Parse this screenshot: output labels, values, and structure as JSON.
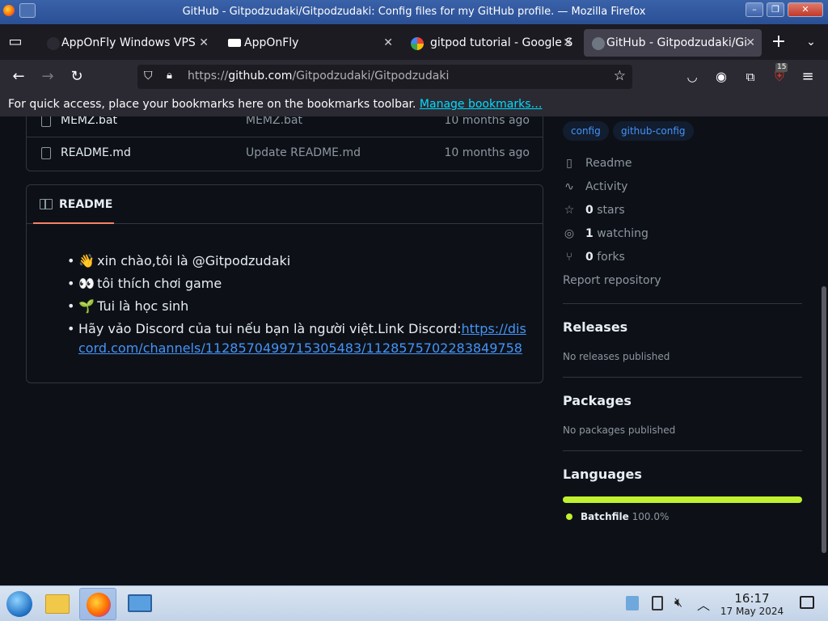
{
  "window": {
    "title": "GitHub - Gitpodzudaki/Gitpodzudaki: Config files for my GitHub profile. — Mozilla Firefox"
  },
  "tabs": [
    {
      "label": "AppOnFly Windows VPS",
      "favicon_color": "#2b2a33",
      "active": false
    },
    {
      "label": "AppOnFly",
      "favicon_color": "#ffffff",
      "active": false
    },
    {
      "label": "gitpod tutorial - Google S",
      "favicon_color": "#4285f4",
      "active": false
    },
    {
      "label": "GitHub - Gitpodzudaki/Gi",
      "favicon_color": "#6e7681",
      "active": true
    }
  ],
  "nav": {
    "url_prefix": "https://",
    "url_host": "github.com",
    "url_path": "/Gitpodzudaki/Gitpodzudaki",
    "extension_badge": "15"
  },
  "bookmarks_bar": {
    "text": "For quick access, place your bookmarks here on the bookmarks toolbar.",
    "link": "Manage bookmarks…"
  },
  "files": [
    {
      "name": "MEMZ.bat",
      "message": "MEMZ.bat",
      "time": "10 months ago"
    },
    {
      "name": "README.md",
      "message": "Update README.md",
      "time": "10 months ago"
    }
  ],
  "readme": {
    "tab_label": "README",
    "items": [
      {
        "emoji": "👋",
        "text": "xin chào,tôi là @Gitpodzudaki"
      },
      {
        "emoji": "👀",
        "text": "tôi thích chơi game"
      },
      {
        "emoji": "🌱",
        "text": "Tui là học sinh"
      }
    ],
    "discord_text": "Hãy vảo Discord của tui nếu bạn là người việt.Link Discord:",
    "discord_link": "https://discord.com/channels/1128570499715305483/1128575702283849758"
  },
  "sidebar": {
    "topics": [
      "config",
      "github-config"
    ],
    "links": [
      {
        "icon": "book-icon",
        "text": "Readme"
      },
      {
        "icon": "pulse-icon",
        "text": "Activity"
      },
      {
        "icon": "star-icon",
        "count": "0",
        "text": "stars"
      },
      {
        "icon": "eye-icon",
        "count": "1",
        "text": "watching"
      },
      {
        "icon": "fork-icon",
        "count": "0",
        "text": "forks"
      }
    ],
    "report": "Report repository",
    "releases": {
      "title": "Releases",
      "empty": "No releases published"
    },
    "packages": {
      "title": "Packages",
      "empty": "No packages published"
    },
    "languages": {
      "title": "Languages",
      "items": [
        {
          "name": "Batchfile",
          "percent": "100.0%",
          "color": "#c1f12e"
        }
      ]
    }
  },
  "taskbar": {
    "time": "16:17",
    "date": "17 May 2024"
  }
}
